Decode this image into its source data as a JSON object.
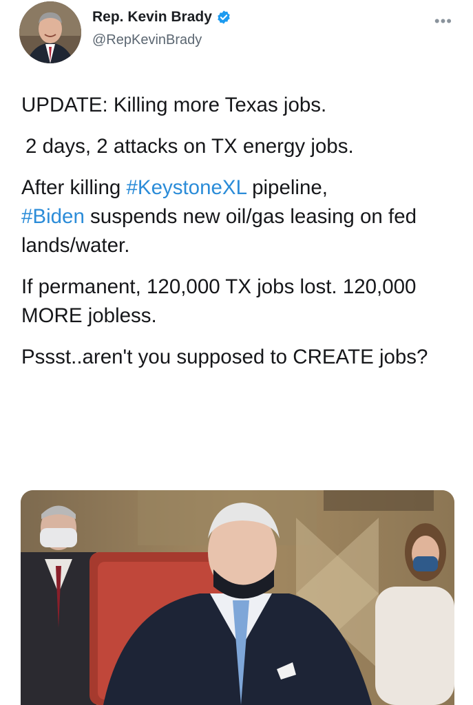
{
  "author": {
    "display_name": "Rep. Kevin Brady",
    "handle": "@RepKevinBrady",
    "verified": true,
    "avatar_icon": "profile-photo",
    "more_icon": "more-options-icon"
  },
  "tweet": {
    "line1": "UPDATE: Killing more Texas jobs.",
    "line2": "2 days, 2 attacks on TX energy jobs.",
    "p3_pre": "After killing ",
    "p3_tag1": "#KeystoneXL",
    "p3_mid": " pipeline,",
    "p3_tag2": "#Biden",
    "p3_post": " suspends new oil/gas leasing on fed lands/water.",
    "p4": "If permanent, 120,000 TX jobs lost. 120,000 MORE jobless.",
    "p5": "Pssst..aren't you supposed to CREATE jobs?"
  },
  "colors": {
    "hashtag": "#2b8cd8",
    "verified_badge": "#1d9bf0",
    "handle": "#5b6671",
    "text": "#16171a"
  },
  "media": {
    "type": "photo",
    "icon": "attached-photo"
  }
}
